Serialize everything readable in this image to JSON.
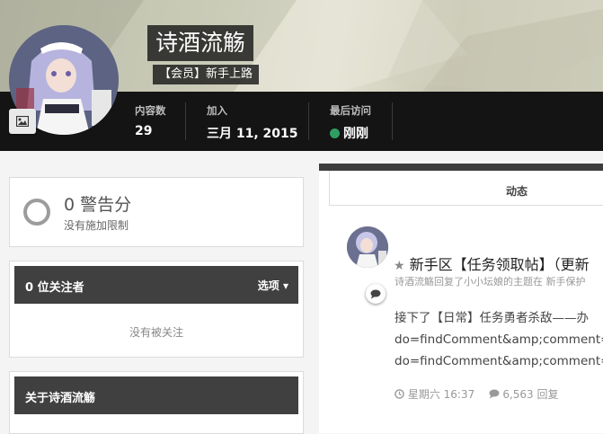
{
  "profile": {
    "name": "诗酒流觞",
    "rank": "【会员】新手上路",
    "stats": [
      {
        "label": "内容数",
        "value": "29"
      },
      {
        "label": "加入",
        "value": "三月 11, 2015"
      },
      {
        "label": "最后访问",
        "value": "刚刚"
      }
    ],
    "online_color": "#2e9e63"
  },
  "warnings": {
    "count_text": "0 警告分",
    "status_text": "没有施加限制"
  },
  "followers": {
    "title": "0 位关注者",
    "options_label": "选项",
    "empty_text": "没有被关注"
  },
  "about": {
    "title": "关于诗酒流觞"
  },
  "activity": {
    "tab_label": "动态",
    "post": {
      "title": "新手区【任务领取帖】（更新",
      "subtitle": "诗酒流觞回复了小小坛娘的主题在 新手保护",
      "body_lines": [
        "接下了【日常】任务勇者杀敌——办",
        "do=findComment&amp;comment=",
        "do=findComment&amp;comment="
      ],
      "time": "星期六 16:37",
      "replies": "6,563 回复"
    }
  },
  "icons": {
    "camera": "image-icon",
    "star": "star-icon",
    "comment": "comment-icon",
    "clock": "clock-icon",
    "caret": "caret-down-icon"
  }
}
